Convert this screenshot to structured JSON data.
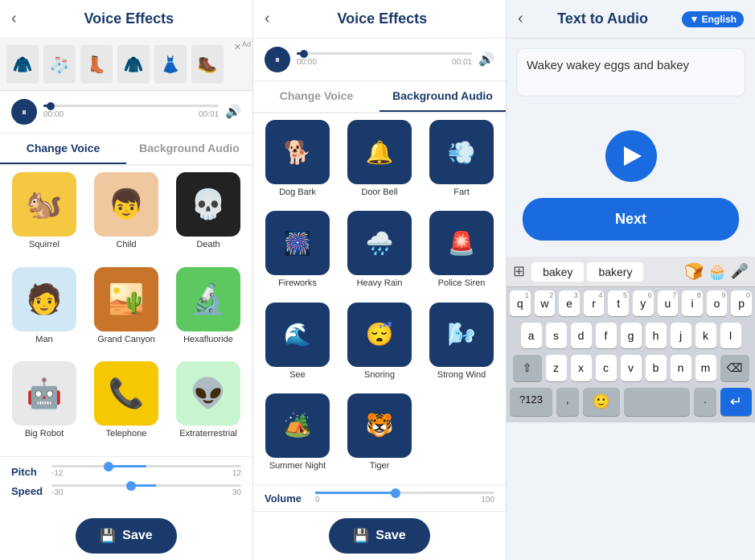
{
  "panel1": {
    "header": {
      "back": "‹",
      "title": "Voice Effects"
    },
    "ad": {
      "items": [
        "🧥",
        "🧦",
        "👢",
        "🧥",
        "👗",
        "🥾"
      ],
      "label": "Ad"
    },
    "player": {
      "time_start": "00:00",
      "time_end": "00:01"
    },
    "tabs": [
      {
        "label": "Change Voice",
        "active": true
      },
      {
        "label": "Background Audio",
        "active": false
      }
    ],
    "voices": [
      {
        "label": "Squirrel",
        "emoji": "🐿️",
        "bg": "#f5c842"
      },
      {
        "label": "Child",
        "emoji": "👦",
        "bg": "#f0c8a0"
      },
      {
        "label": "Death",
        "emoji": "💀",
        "bg": "#222"
      },
      {
        "label": "Man",
        "emoji": "🧑",
        "bg": "#d0e8f5"
      },
      {
        "label": "Grand Canyon",
        "emoji": "🏜️",
        "bg": "#c8742a"
      },
      {
        "label": "Hexafluoride",
        "emoji": "🔬",
        "bg": "#5ec860"
      },
      {
        "label": "Big Robot",
        "emoji": "🤖",
        "bg": "#e8e8e8"
      },
      {
        "label": "Telephone",
        "emoji": "📞",
        "bg": "#f5c800"
      },
      {
        "label": "Extraterrestrial",
        "emoji": "👽",
        "bg": "#c8f5d0"
      }
    ],
    "pitch": {
      "label": "Pitch",
      "min": "-12",
      "max": "12"
    },
    "speed": {
      "label": "Speed",
      "min": "-30",
      "max": "30"
    },
    "save_button": "Save"
  },
  "panel2": {
    "header": {
      "back": "‹",
      "title": "Voice Effects"
    },
    "player": {
      "time_start": "00:00",
      "time_end": "00:01"
    },
    "tabs": [
      {
        "label": "Change Voice",
        "active": false
      },
      {
        "label": "Background Audio",
        "active": true
      }
    ],
    "sounds": [
      {
        "label": "Dog Bark",
        "emoji": "🐕"
      },
      {
        "label": "Door Bell",
        "emoji": "🔔"
      },
      {
        "label": "Fart",
        "emoji": "💨"
      },
      {
        "label": "Fireworks",
        "emoji": "🎆"
      },
      {
        "label": "Heavy Rain",
        "emoji": "🌧️"
      },
      {
        "label": "Police Siren",
        "emoji": "🚨"
      },
      {
        "label": "See",
        "emoji": "🌊"
      },
      {
        "label": "Snoring",
        "emoji": "😴"
      },
      {
        "label": "Strong Wind",
        "emoji": "🌬️"
      },
      {
        "label": "Summer Night",
        "emoji": "🏕️"
      },
      {
        "label": "Tiger",
        "emoji": "🐯"
      }
    ],
    "volume": {
      "label": "Volume",
      "min": "0",
      "max": "100"
    },
    "save_button": "Save"
  },
  "panel3": {
    "header": {
      "back": "‹",
      "title": "Text to Audio",
      "badge": "▼ English"
    },
    "text": "Wakey wakey eggs and bakey",
    "next_button": "Next",
    "keyboard": {
      "suggestions": [
        "bakey",
        "bakery"
      ],
      "rows": [
        [
          "q",
          "w",
          "e",
          "r",
          "t",
          "y",
          "u",
          "i",
          "o",
          "p"
        ],
        [
          "a",
          "s",
          "d",
          "f",
          "g",
          "h",
          "j",
          "k",
          "l"
        ],
        [
          "z",
          "x",
          "c",
          "v",
          "b",
          "n",
          "m"
        ]
      ],
      "numbers": [
        "1",
        "2",
        "3",
        "4",
        "5",
        "6",
        "7",
        "8",
        "9",
        "0"
      ],
      "bottom": [
        "?123",
        ",",
        "emoji",
        "space",
        ".",
        "enter"
      ]
    }
  }
}
